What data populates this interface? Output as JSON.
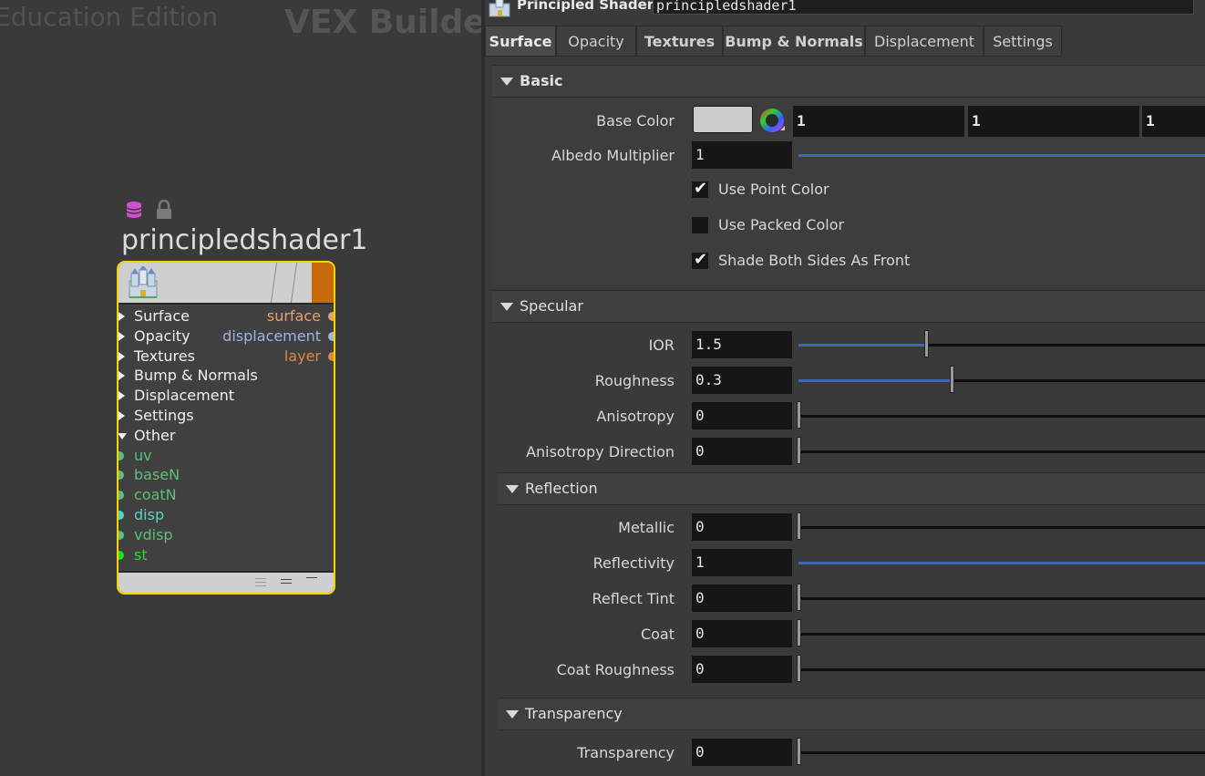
{
  "network": {
    "watermark": "Education Edition",
    "context_title": "VEX Builder",
    "node": {
      "name": "principledshader1",
      "inputs": [
        "Surface",
        "Opacity",
        "Textures",
        "Bump & Normals",
        "Displacement",
        "Settings"
      ],
      "other_label": "Other",
      "outputs": [
        {
          "label": "surface",
          "color": "#e8a06c"
        },
        {
          "label": "displacement",
          "color": "#9fb4e0"
        },
        {
          "label": "layer",
          "color": "#e0883a"
        }
      ],
      "other_inputs": [
        {
          "label": "uv",
          "color": "#5cc07a"
        },
        {
          "label": "baseN",
          "color": "#5cc07a"
        },
        {
          "label": "coatN",
          "color": "#5cc07a"
        },
        {
          "label": "disp",
          "color": "#5ccfc0"
        },
        {
          "label": "vdisp",
          "color": "#5cc07a"
        },
        {
          "label": "st",
          "color": "#22e022"
        }
      ],
      "border_color": "#f5d400"
    }
  },
  "params": {
    "node_type": "Principled Shader",
    "node_name": "principledshader1",
    "tabs": [
      "Surface",
      "Opacity",
      "Textures",
      "Bump & Normals",
      "Displacement",
      "Settings"
    ],
    "active_tab": "Surface",
    "sections": {
      "basic": {
        "title": "Basic",
        "base_color_label": "Base Color",
        "base_color_values": [
          "1",
          "1",
          "1"
        ],
        "albedo_label": "Albedo Multiplier",
        "albedo_value": "1",
        "use_point_color": {
          "label": "Use Point Color",
          "checked": true
        },
        "use_packed_color": {
          "label": "Use Packed Color",
          "checked": false
        },
        "shade_both_sides": {
          "label": "Shade Both Sides As Front",
          "checked": true
        }
      },
      "specular": {
        "title": "Specular",
        "ior": {
          "label": "IOR",
          "value": "1.5"
        },
        "roughness": {
          "label": "Roughness",
          "value": "0.3"
        },
        "anisotropy": {
          "label": "Anisotropy",
          "value": "0"
        },
        "aniso_dir": {
          "label": "Anisotropy Direction",
          "value": "0"
        }
      },
      "reflection": {
        "title": "Reflection",
        "metallic": {
          "label": "Metallic",
          "value": "0"
        },
        "reflectivity": {
          "label": "Reflectivity",
          "value": "1"
        },
        "reflect_tint": {
          "label": "Reflect Tint",
          "value": "0"
        },
        "coat": {
          "label": "Coat",
          "value": "0"
        },
        "coat_roughness": {
          "label": "Coat Roughness",
          "value": "0"
        }
      },
      "transparency": {
        "title": "Transparency",
        "transparency": {
          "label": "Transparency",
          "value": "0"
        }
      }
    },
    "accent_color": "#3e67b5"
  }
}
